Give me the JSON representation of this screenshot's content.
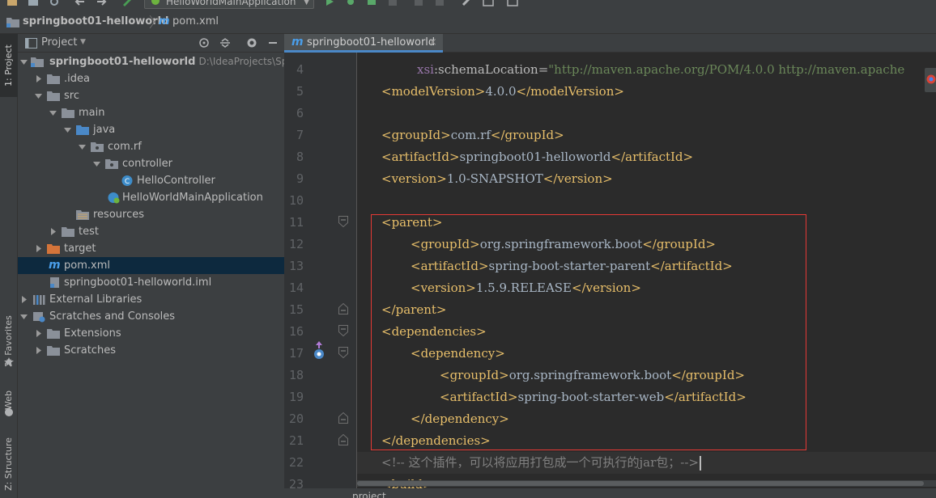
{
  "toolbar": {
    "run_config": "HelloWorldMainApplication",
    "icons": [
      "open-icon",
      "save-icon",
      "sync-icon",
      "back-icon",
      "forward-icon",
      "build-icon",
      "run-icon",
      "debug-icon",
      "coverage-icon",
      "stop-icon",
      "settings-icon",
      "project-structure-icon"
    ]
  },
  "navbar": {
    "project": "springboot01-helloworld",
    "file": "pom.xml"
  },
  "left_strip": {
    "project_tab": "1: Project",
    "favorites_tab": "2: Favorites",
    "web_tab": "Web",
    "structure_tab": "Z: Structure"
  },
  "project_panel": {
    "title": "Project",
    "tree": [
      {
        "label": "springboot01-helloworld",
        "path": "D:\\IdeaProjects\\Spring",
        "icon": "module-folder-icon",
        "expanded": true
      },
      {
        "label": ".idea",
        "icon": "folder-icon",
        "expanded": false
      },
      {
        "label": "src",
        "icon": "folder-icon",
        "expanded": true
      },
      {
        "label": "main",
        "icon": "folder-icon",
        "expanded": true
      },
      {
        "label": "java",
        "icon": "source-folder-icon",
        "expanded": true
      },
      {
        "label": "com.rf",
        "icon": "package-icon",
        "expanded": true
      },
      {
        "label": "controller",
        "icon": "package-icon",
        "expanded": true
      },
      {
        "label": "HelloController",
        "icon": "class-icon"
      },
      {
        "label": "HelloWorldMainApplication",
        "icon": "spring-boot-class-icon"
      },
      {
        "label": "resources",
        "icon": "resources-folder-icon"
      },
      {
        "label": "test",
        "icon": "folder-icon",
        "expanded": false
      },
      {
        "label": "target",
        "icon": "excluded-folder-icon",
        "expanded": false
      },
      {
        "label": "pom.xml",
        "icon": "maven-icon",
        "selected": true
      },
      {
        "label": "springboot01-helloworld.iml",
        "icon": "iml-file-icon"
      },
      {
        "label": "External Libraries",
        "icon": "libraries-icon",
        "expanded": false
      },
      {
        "label": "Scratches and Consoles",
        "icon": "scratches-icon",
        "expanded": true
      },
      {
        "label": "Extensions",
        "icon": "folder-icon",
        "expanded": false
      },
      {
        "label": "Scratches",
        "icon": "folder-icon",
        "expanded": false
      }
    ]
  },
  "editor": {
    "tab_label": "springboot01-helloworld",
    "tab_close": "×",
    "line_numbers": [
      "4",
      "5",
      "6",
      "7",
      "8",
      "9",
      "10",
      "11",
      "12",
      "13",
      "14",
      "15",
      "16",
      "17",
      "18",
      "19",
      "20",
      "21",
      "22",
      "23"
    ],
    "code": {
      "l4_ns": "xsi",
      "l4_attr": ":schemaLocation",
      "l4_eq": "=",
      "l4_str": "\"http://maven.apache.org/POM/4.0.0 http://maven.apache",
      "l5_open": "<modelVersion>",
      "l5_text": "4.0.0",
      "l5_close": "</modelVersion>",
      "l7_open": "<groupId>",
      "l7_text": "com.rf",
      "l7_close": "</groupId>",
      "l8_open": "<artifactId>",
      "l8_text": "springboot01-helloworld",
      "l8_close": "</artifactId>",
      "l9_open": "<version>",
      "l9_text": "1.0-SNAPSHOT",
      "l9_close": "</version>",
      "l11": "<parent>",
      "l12_open": "<groupId>",
      "l12_text": "org.springframework.boot",
      "l12_close": "</groupId>",
      "l13_open": "<artifactId>",
      "l13_text": "spring-boot-starter-parent",
      "l13_close": "</artifactId>",
      "l14_open": "<version>",
      "l14_text": "1.5.9.RELEASE",
      "l14_close": "</version>",
      "l15": "</parent>",
      "l16": "<dependencies>",
      "l17": "<dependency>",
      "l18_open": "<groupId>",
      "l18_text": "org.springframework.boot",
      "l18_close": "</groupId>",
      "l19_open": "<artifactId>",
      "l19_text": "spring-boot-starter-web",
      "l19_close": "</artifactId>",
      "l20": "</dependency>",
      "l21": "</dependencies>",
      "l22": "<!-- 这个插件，可以将应用打包成一个可执行的jar包；-->",
      "l23": "<build>"
    }
  },
  "bottom_bar": {
    "crumb": "project"
  },
  "colors": {
    "tag": "#e8bf6a",
    "text": "#a9b7c6",
    "namespace": "#9876aa",
    "string": "#6a8759",
    "comment": "#808080",
    "highlight_box": "#e53935",
    "selection": "#0d293e"
  }
}
